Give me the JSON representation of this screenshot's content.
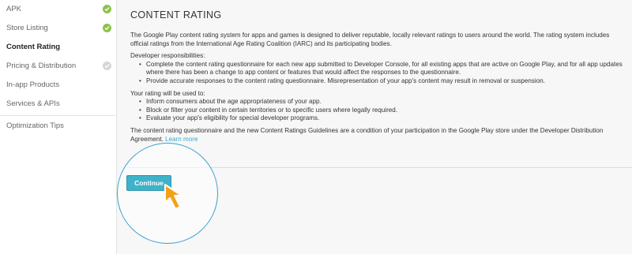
{
  "sidebar": {
    "items": [
      {
        "label": "APK",
        "status": "done"
      },
      {
        "label": "Store Listing",
        "status": "done"
      },
      {
        "label": "Content Rating",
        "status": "active"
      },
      {
        "label": "Pricing & Distribution",
        "status": "pending"
      },
      {
        "label": "In-app Products",
        "status": "none"
      },
      {
        "label": "Services & APIs",
        "status": "none"
      }
    ],
    "footer_item": {
      "label": "Optimization Tips"
    }
  },
  "main": {
    "title": "CONTENT RATING",
    "intro": "The Google Play content rating system for apps and games is designed to deliver reputable, locally relevant ratings to users around the world. The rating system includes official ratings from the International Age Rating Coalition (IARC) and its participating bodies.",
    "responsibilities_heading": "Developer responsibilities:",
    "responsibilities": [
      "Complete the content rating questionnaire for each new app submitted to Developer Console, for all existing apps that are active on Google Play, and for all app updates where there has been a change to app content or features that would affect the responses to the questionnaire.",
      "Provide accurate responses to the content rating questionnaire. Misrepresentation of your app's content may result in removal or suspension."
    ],
    "uses_heading": "Your rating will be used to:",
    "uses": [
      "Inform consumers about the age appropriateness of your app.",
      "Block or filter your content in certain territories or to specific users where legally required.",
      "Evaluate your app's eligibility for special developer programs."
    ],
    "condition_text": "The content rating questionnaire and the new Content Ratings Guidelines are a condition of your participation in the Google Play store under the Developer Distribution Agreement.",
    "learn_more": "Learn more",
    "continue_label": "Continue"
  },
  "colors": {
    "check_green": "#8bc34a",
    "check_grey": "#d6d6d6",
    "button_teal": "#3fb1c9",
    "link_blue": "#33a9cf",
    "highlight_circle": "#3aa3d1",
    "cursor_orange": "#f5a01a"
  },
  "icons": {
    "done": "check-circle-icon",
    "pending": "check-circle-icon",
    "pointer": "pointer-arrow-icon"
  }
}
